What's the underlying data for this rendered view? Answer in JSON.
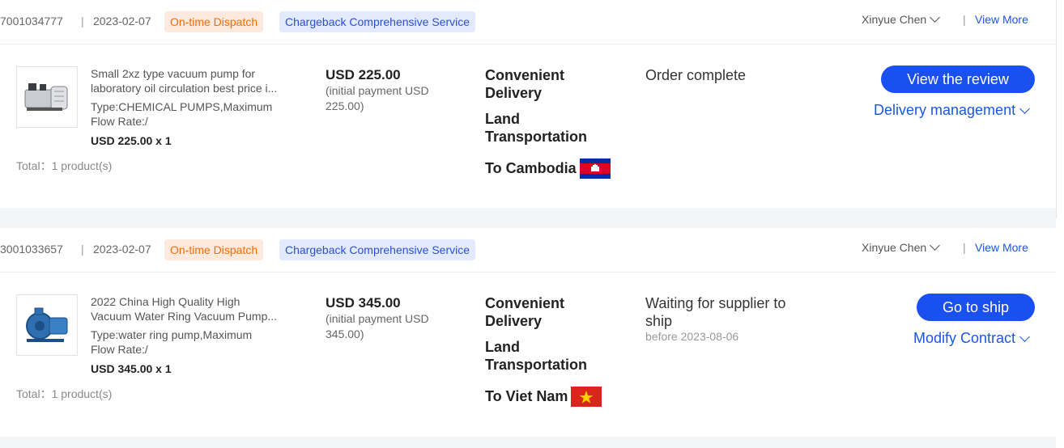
{
  "orders": [
    {
      "order_no": "7001034777",
      "separator": "|",
      "date": "2023-02-07",
      "tag_dispatch": "On-time Dispatch",
      "tag_chargeback": "Chargeback Comprehensive Service",
      "owner": "Xinyue Chen",
      "view_more": "View More",
      "product": {
        "name_line1": "Small 2xz type vacuum pump for",
        "name_line2": "laboratory oil circulation best price i...",
        "type_line1": "Type:CHEMICAL PUMPS,Maximum",
        "type_line2": "Flow Rate:/",
        "qty": "USD 225.00 x 1",
        "thumb_icon": "vacuum-pump-icon"
      },
      "total": "Total：1 product(s)",
      "price": "USD 225.00",
      "initial_payment": "(initial payment USD 225.00)",
      "shipping_line1": "Convenient Delivery",
      "shipping_line2": "Land Transportation",
      "destination": "To Cambodia",
      "flag_icon": "cambodia-flag-icon",
      "status": "Order complete",
      "status_sub": "",
      "primary_action": "View the review",
      "secondary_action": "Delivery management"
    },
    {
      "order_no": "3001033657",
      "separator": "|",
      "date": "2023-02-07",
      "tag_dispatch": "On-time Dispatch",
      "tag_chargeback": "Chargeback Comprehensive Service",
      "owner": "Xinyue Chen",
      "view_more": "View More",
      "product": {
        "name_line1": "2022 China High Quality High",
        "name_line2": "Vacuum Water Ring Vacuum Pump...",
        "type_line1": "Type:water ring pump,Maximum",
        "type_line2": "Flow Rate:/",
        "qty": "USD 345.00 x 1",
        "thumb_icon": "water-ring-pump-icon"
      },
      "total": "Total：1 product(s)",
      "price": "USD 345.00",
      "initial_payment": "(initial payment USD 345.00)",
      "shipping_line1": "Convenient Delivery",
      "shipping_line2": "Land Transportation",
      "destination": "To Viet Nam",
      "flag_icon": "vietnam-flag-icon",
      "status": "Waiting for supplier to ship",
      "status_sub": "before 2023-08-06",
      "primary_action": "Go to ship",
      "secondary_action": "Modify Contract"
    }
  ],
  "colors": {
    "accent": "#1a4ff0",
    "link": "#1a56e8",
    "dispatch_tag_bg": "#fde9dd",
    "dispatch_tag_text": "#ff6a00",
    "chargeback_tag_bg": "#e3eafd",
    "chargeback_tag_text": "#2a4fd6"
  }
}
